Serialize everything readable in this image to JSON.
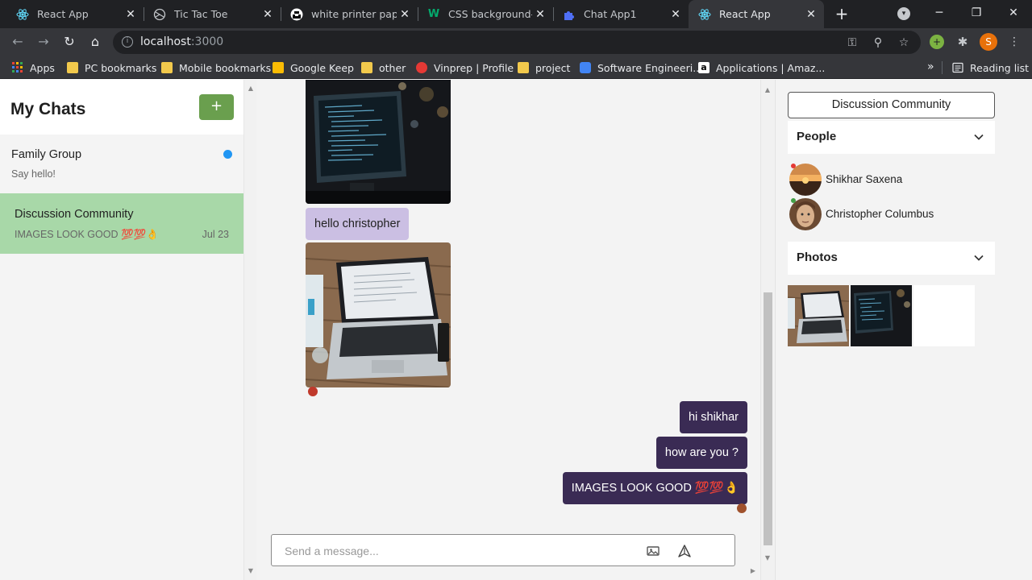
{
  "browser": {
    "tabs": [
      {
        "title": "React App",
        "icon": "react-icon"
      },
      {
        "title": "Tic Tac Toe",
        "icon": "globe-icon"
      },
      {
        "title": "white printer paper",
        "icon": "unsplash-icon"
      },
      {
        "title": "CSS background-im",
        "icon": "w3schools-icon"
      },
      {
        "title": "Chat App1",
        "icon": "puzzle-icon"
      },
      {
        "title": "React App",
        "icon": "react-icon"
      }
    ],
    "url_host": "localhost",
    "url_port": ":3000",
    "profile_initial": "S",
    "bookmarks": [
      {
        "label": "Apps",
        "icon": "apps-grid-icon"
      },
      {
        "label": "PC bookmarks",
        "icon": "folder-icon"
      },
      {
        "label": "Mobile bookmarks",
        "icon": "folder-icon"
      },
      {
        "label": "Google Keep",
        "icon": "keep-icon"
      },
      {
        "label": "other",
        "icon": "folder-icon"
      },
      {
        "label": "Vinprep | Profile",
        "icon": "vinprep-icon"
      },
      {
        "label": "project",
        "icon": "folder-icon"
      },
      {
        "label": "Software Engineeri...",
        "icon": "bookmark-icon"
      },
      {
        "label": "Applications | Amaz...",
        "icon": "amazon-icon"
      }
    ],
    "more_bookmarks": "»",
    "reading_list": "Reading list"
  },
  "sidebar": {
    "title": "My Chats",
    "add_label": "+",
    "chats": [
      {
        "name": "Family Group",
        "last": "Say hello!",
        "date": "",
        "unread": true,
        "selected": false
      },
      {
        "name": "Discussion Community",
        "last": "IMAGES LOOK GOOD 💯💯👌",
        "date": "Jul 23",
        "unread": false,
        "selected": true
      }
    ]
  },
  "chat": {
    "messages": [
      {
        "type": "image",
        "direction": "in",
        "subject": "monitor-code-photo"
      },
      {
        "type": "text",
        "direction": "in",
        "text": "hello christopher"
      },
      {
        "type": "image",
        "direction": "in",
        "subject": "laptop-desk-photo"
      },
      {
        "type": "text",
        "direction": "out",
        "text": "hi shikhar"
      },
      {
        "type": "text",
        "direction": "out",
        "text": "how are you ?"
      },
      {
        "type": "text",
        "direction": "out",
        "text": "IMAGES LOOK GOOD 💯💯👌"
      }
    ],
    "input_placeholder": "Send a message..."
  },
  "details": {
    "chat_name": "Discussion Community",
    "people_title": "People",
    "people": [
      {
        "name": "Shikhar Saxena",
        "status_color": "#e53935"
      },
      {
        "name": "Christopher Columbus",
        "status_color": "#43a047"
      }
    ],
    "photos_title": "Photos"
  },
  "colors": {
    "selected_chat": "#a8d8a8",
    "add_button": "#6a9f4e",
    "incoming_bubble": "#cbbfe3",
    "outgoing_bubble": "#3a2b54",
    "unread_dot": "#2196f3"
  }
}
